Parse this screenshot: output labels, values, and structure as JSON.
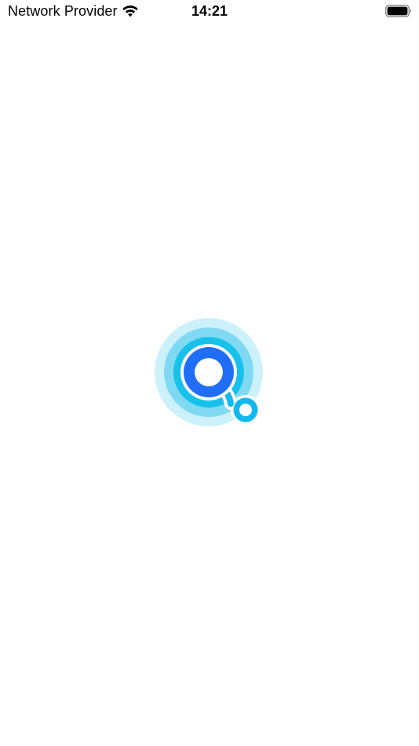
{
  "status_bar": {
    "carrier": "Network Provider",
    "time": "14:21",
    "icons": {
      "wifi": "wifi-icon",
      "battery": "battery-icon"
    }
  },
  "splash": {
    "logo_icon": "app-logo-icon",
    "colors": {
      "outer_ring": "#cdf1fb",
      "middle_ring": "#7fd9f3",
      "inner_ring": "#17c1ea",
      "core": "#1f6ef5",
      "handle": "#10b9ee"
    }
  }
}
